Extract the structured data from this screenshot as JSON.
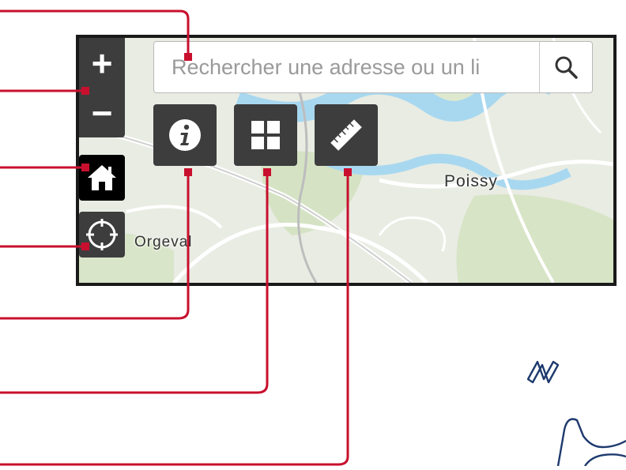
{
  "map": {
    "labels": {
      "poissy": "Poissy",
      "orgeval": "Orgeval"
    }
  },
  "controls": {
    "zoom_in_label": "+",
    "zoom_out_label": "−",
    "home_icon": "home-icon",
    "locate_icon": "crosshair-icon"
  },
  "search": {
    "placeholder": "Rechercher une adresse ou un li",
    "button_icon": "search-icon"
  },
  "tools": [
    {
      "icon": "info-icon"
    },
    {
      "icon": "grid-icon"
    },
    {
      "icon": "ruler-icon"
    }
  ],
  "compass": {
    "letter": "N"
  },
  "colors": {
    "callout": "#c8102e",
    "control_bg": "#3d3d3d",
    "frame": "#1a1a1a",
    "water": "#a8d8f0"
  }
}
